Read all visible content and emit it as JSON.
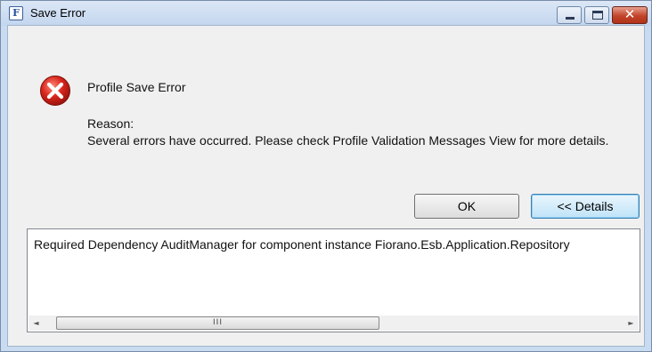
{
  "window": {
    "title": "Save Error",
    "app_icon_letter": "F",
    "close_symbol": "✕",
    "title_bar_color": "#c9dbf0"
  },
  "message": {
    "title": "Profile Save Error",
    "reason_label": "Reason:",
    "reason_text": "Several errors have occurred. Please check Profile Validation Messages View for more details."
  },
  "icons": {
    "app": "fiorano-app-icon",
    "error": "error-icon",
    "error_color": "#c8201b"
  },
  "buttons": {
    "ok_label": "OK",
    "details_label": "<< Details"
  },
  "details": {
    "text": "Required Dependency AuditManager for component instance Fiorano.Esb.Application.Repository",
    "scroll_left": "◄",
    "scroll_right": "►",
    "thumb_grip": "III"
  }
}
